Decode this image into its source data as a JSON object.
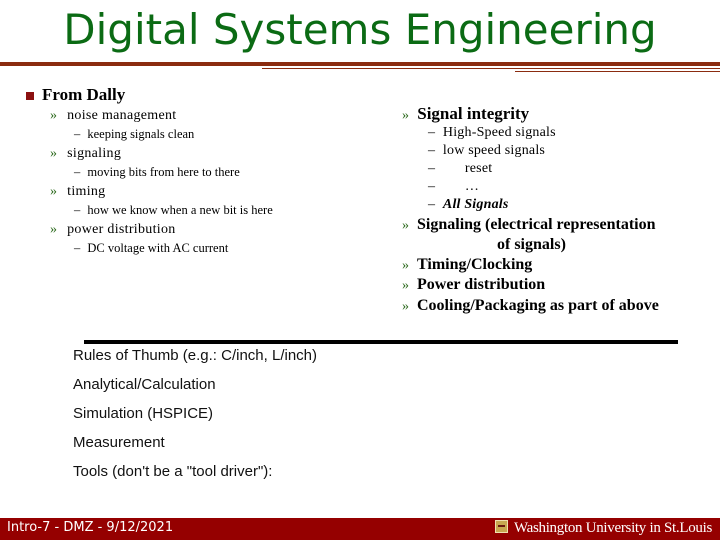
{
  "slide": {
    "title": "Digital Systems Engineering"
  },
  "left": {
    "heading": "From Dally",
    "bullet_glyph": "»",
    "dash_glyph": "–",
    "items": [
      {
        "label": "noise management",
        "sub": "keeping signals clean"
      },
      {
        "label": "signaling",
        "sub": "moving bits from here to there"
      },
      {
        "label": "timing",
        "sub": "how we know when a new bit is here"
      },
      {
        "label": "power distribution",
        "sub": "DC voltage with AC current"
      }
    ]
  },
  "right": {
    "heading": "Signal integrity",
    "subitems": [
      {
        "text": "High-Speed signals",
        "style": "normal"
      },
      {
        "text": "low speed signals",
        "style": "normal"
      },
      {
        "text": "reset",
        "style": "indented"
      },
      {
        "text": "…",
        "style": "indented"
      },
      {
        "text": "All Signals",
        "style": "bold-italic"
      }
    ],
    "items": [
      "Signaling (electrical representation",
      "of signals)",
      "Timing/Clocking",
      "Power distribution",
      "Cooling/Packaging as part of above"
    ]
  },
  "methods": [
    "Rules of Thumb (e.g.: C/inch, L/inch)",
    "Analytical/Calculation",
    "Simulation (HSPICE)",
    "Measurement",
    "Tools (don't be a \"tool driver\"):"
  ],
  "footer": {
    "left": "Intro-7 - DMZ - 9/12/2021",
    "right": "Washington University in St.Louis"
  },
  "colors": {
    "title": "#0b6b14",
    "rule": "#8b2c10",
    "footer_bg": "#950000",
    "bullet": "#8b1010",
    "chevron": "#2e6b1f"
  }
}
